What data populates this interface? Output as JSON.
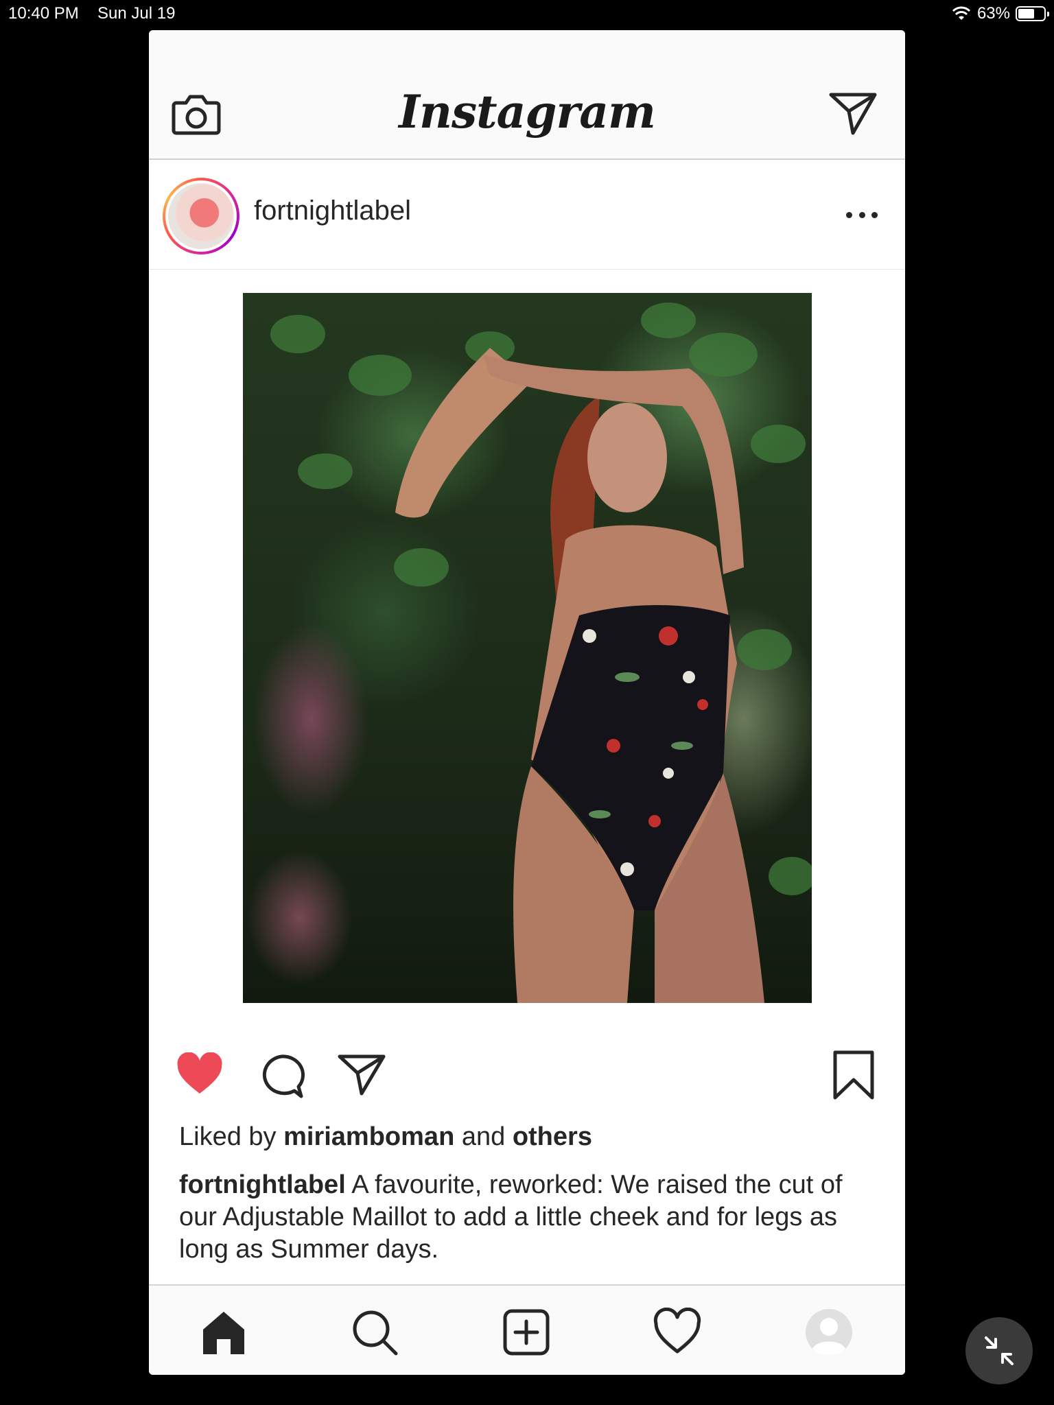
{
  "status_bar": {
    "time": "10:40 PM",
    "date": "Sun Jul 19",
    "battery": "63%",
    "battery_level": 0.63
  },
  "app": {
    "logo": "Instagram",
    "icons": {
      "camera": "camera-icon",
      "direct": "paper-plane-icon"
    }
  },
  "post": {
    "username": "fortnightlabel",
    "liked_by_prefix": "Liked by",
    "liked_by_user": "miriamboman",
    "liked_by_and": "and",
    "liked_by_others": "others",
    "caption_user": "fortnightlabel",
    "caption_text": " A favourite, reworked: We raised the cut of our Adjustable Maillot to add a little cheek and for legs as long as Summer days.",
    "liked": true,
    "like_color": "#ed4956"
  },
  "nav": {
    "items": [
      "home-icon",
      "search-icon",
      "add-post-icon",
      "heart-icon",
      "profile-icon"
    ]
  }
}
